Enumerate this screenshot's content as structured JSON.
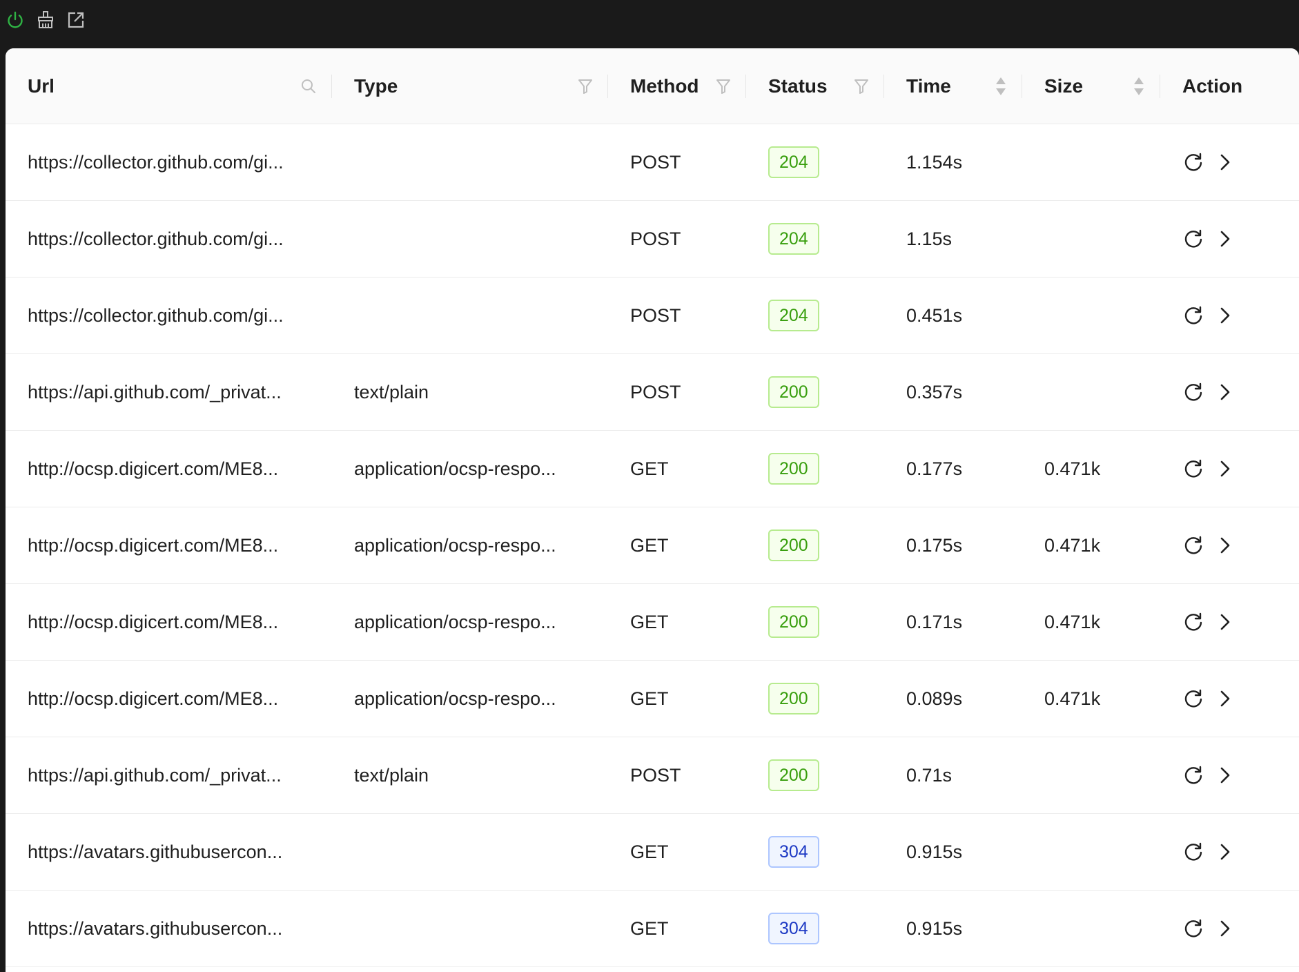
{
  "toolbar": {
    "icons": [
      "power-icon",
      "clear-icon",
      "open-external-icon"
    ],
    "colors": {
      "power": "#2fb344",
      "icon": "#bfbfbf"
    }
  },
  "table": {
    "columns": {
      "url": "Url",
      "type": "Type",
      "method": "Method",
      "status": "Status",
      "time": "Time",
      "size": "Size",
      "action": "Action"
    },
    "rows": [
      {
        "url": "https://collector.github.com/gi...",
        "type": "",
        "method": "POST",
        "status": "204",
        "time": "1.154s",
        "size": ""
      },
      {
        "url": "https://collector.github.com/gi...",
        "type": "",
        "method": "POST",
        "status": "204",
        "time": "1.15s",
        "size": ""
      },
      {
        "url": "https://collector.github.com/gi...",
        "type": "",
        "method": "POST",
        "status": "204",
        "time": "0.451s",
        "size": ""
      },
      {
        "url": "https://api.github.com/_privat...",
        "type": "text/plain",
        "method": "POST",
        "status": "200",
        "time": "0.357s",
        "size": ""
      },
      {
        "url": "http://ocsp.digicert.com/ME8...",
        "type": "application/ocsp-respo...",
        "method": "GET",
        "status": "200",
        "time": "0.177s",
        "size": "0.471k"
      },
      {
        "url": "http://ocsp.digicert.com/ME8...",
        "type": "application/ocsp-respo...",
        "method": "GET",
        "status": "200",
        "time": "0.175s",
        "size": "0.471k"
      },
      {
        "url": "http://ocsp.digicert.com/ME8...",
        "type": "application/ocsp-respo...",
        "method": "GET",
        "status": "200",
        "time": "0.171s",
        "size": "0.471k"
      },
      {
        "url": "http://ocsp.digicert.com/ME8...",
        "type": "application/ocsp-respo...",
        "method": "GET",
        "status": "200",
        "time": "0.089s",
        "size": "0.471k"
      },
      {
        "url": "https://api.github.com/_privat...",
        "type": "text/plain",
        "method": "POST",
        "status": "200",
        "time": "0.71s",
        "size": ""
      },
      {
        "url": "https://avatars.githubusercon...",
        "type": "",
        "method": "GET",
        "status": "304",
        "time": "0.915s",
        "size": ""
      },
      {
        "url": "https://avatars.githubusercon...",
        "type": "",
        "method": "GET",
        "status": "304",
        "time": "0.915s",
        "size": ""
      }
    ]
  }
}
